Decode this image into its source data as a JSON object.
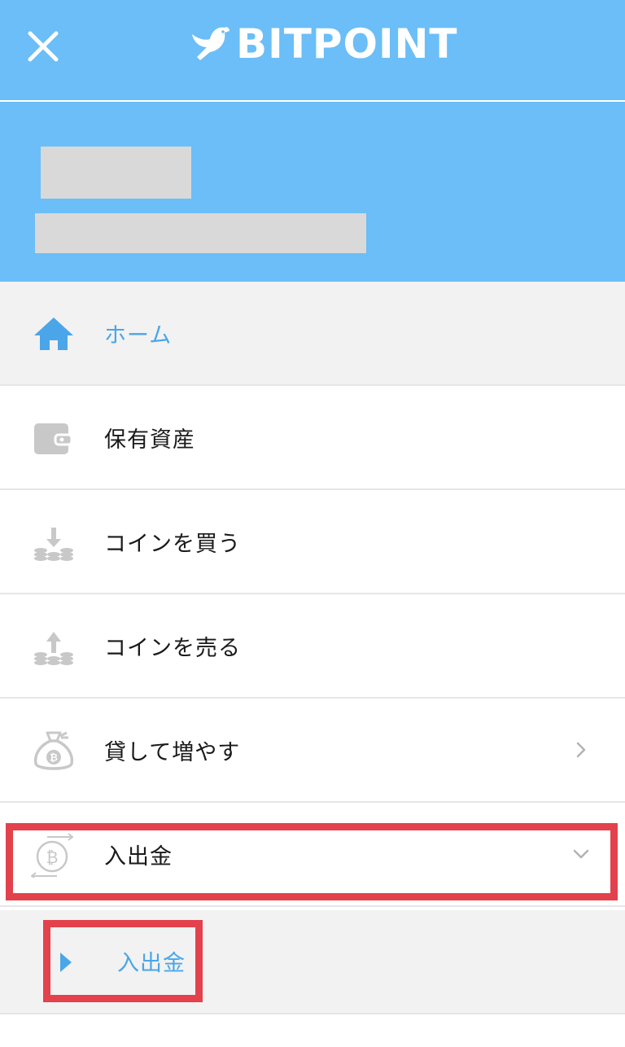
{
  "header": {
    "brand": "BITPOINT",
    "close_icon": "close-icon",
    "logo_icon": "bird-logo-icon",
    "background": "#6bbef7"
  },
  "menu": {
    "items": [
      {
        "label": "ホーム",
        "icon": "home-icon",
        "active": true
      },
      {
        "label": "保有資産",
        "icon": "wallet-icon"
      },
      {
        "label": "コインを買う",
        "icon": "coins-download-icon"
      },
      {
        "label": "コインを売る",
        "icon": "coins-upload-icon"
      },
      {
        "label": "貸して増やす",
        "icon": "money-bag-bitcoin-icon",
        "trailing": "chevron-right-icon"
      },
      {
        "label": "入出金",
        "icon": "bitcoin-transfer-icon",
        "trailing": "chevron-down-icon",
        "highlighted": true
      }
    ],
    "submenu": [
      {
        "label": "入出金",
        "icon": "caret-right-icon",
        "highlighted": true
      }
    ]
  },
  "colors": {
    "accent": "#4aa6e8",
    "highlight": "#e3424c",
    "active_bg": "#f2f2f2"
  }
}
